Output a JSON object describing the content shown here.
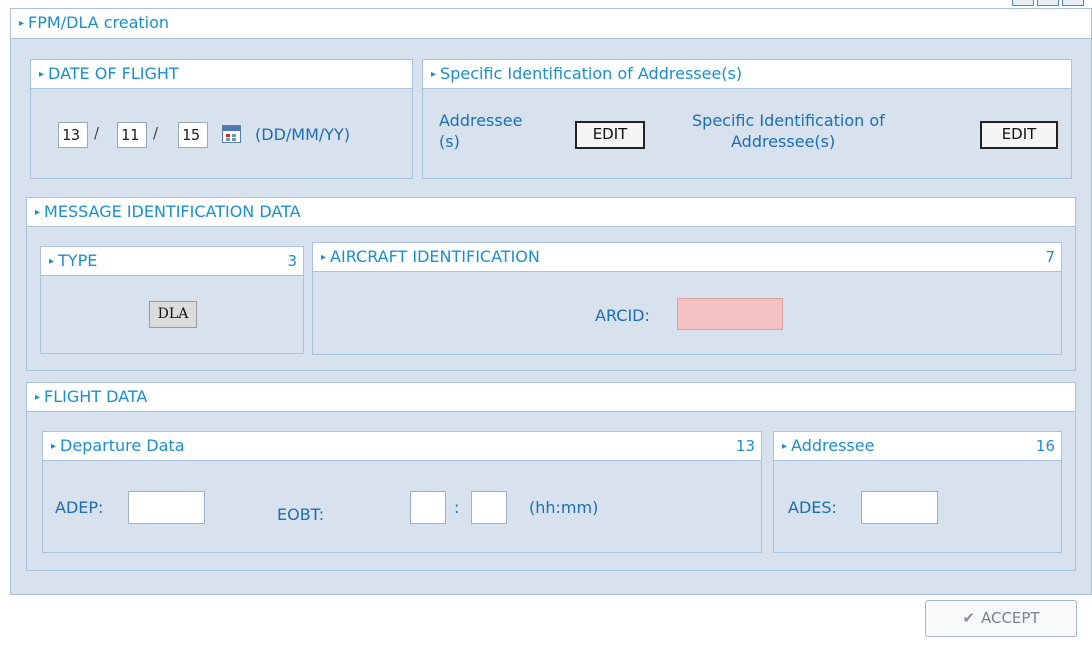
{
  "window": {
    "title": "FPM/DLA creation"
  },
  "date_of_flight": {
    "title": "DATE OF FLIGHT",
    "day": "13",
    "month": "11",
    "year": "15",
    "sep": "/",
    "format": "(DD/MM/YY)"
  },
  "addressees": {
    "title": "Specific Identification of Addressee(s)",
    "addressee_label_line1": "Addressee",
    "addressee_label_line2": "(s)",
    "edit_label_1": "EDIT",
    "specific_label_line1": "Specific Identification of",
    "specific_label_line2": "Addressee(s)",
    "edit_label_2": "EDIT"
  },
  "message_identification": {
    "title": "MESSAGE IDENTIFICATION DATA",
    "type": {
      "title": "TYPE",
      "field_no": "3",
      "value": "DLA"
    },
    "aircraft": {
      "title": "AIRCRAFT IDENTIFICATION",
      "field_no": "7",
      "arcid_label": "ARCID:",
      "arcid_value": ""
    }
  },
  "flight_data": {
    "title": "FLIGHT DATA",
    "departure": {
      "title": "Departure Data",
      "field_no": "13",
      "adep_label": "ADEP:",
      "adep_value": "",
      "eobt_label": "EOBT:",
      "eobt_hh": "",
      "eobt_colon": ":",
      "eobt_mm": "",
      "eobt_format": "(hh:mm)"
    },
    "destination": {
      "title": "Addressee",
      "field_no": "16",
      "ades_label": "ADES:",
      "ades_value": ""
    }
  },
  "footer": {
    "accept_label": "ACCEPT",
    "accept_icon": "check-icon"
  },
  "colors": {
    "title": "#1a8fd0",
    "panel_bg": "#d7e2ee",
    "border": "#a9c3dc",
    "arcid_bg": "#f4c2c2"
  }
}
